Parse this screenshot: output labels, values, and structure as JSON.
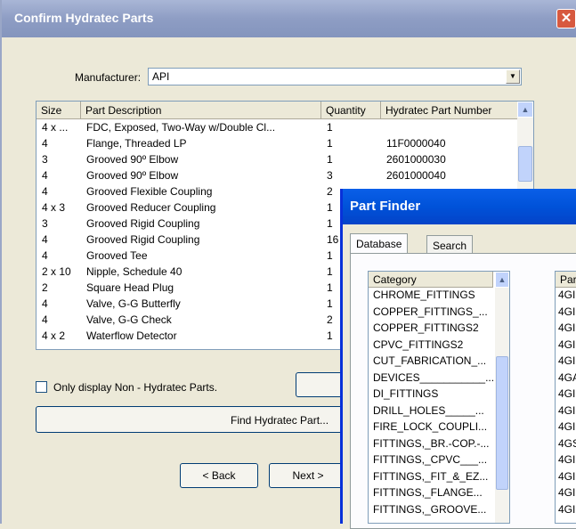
{
  "window": {
    "title": "Confirm Hydratec Parts",
    "close_glyph": "✕"
  },
  "manufacturer": {
    "label": "Manufacturer:",
    "value": "API"
  },
  "grid": {
    "columns": [
      "Size",
      "Part Description",
      "Quantity",
      "Hydratec Part Number"
    ],
    "rows": [
      [
        "4 x ...",
        "FDC, Exposed, Two-Way w/Double Cl...",
        "1",
        ""
      ],
      [
        "4",
        "Flange, Threaded LP",
        "1",
        "11F0000040"
      ],
      [
        "3",
        "Grooved 90º Elbow",
        "1",
        "2601000030"
      ],
      [
        "4",
        "Grooved 90º Elbow",
        "3",
        "2601000040"
      ],
      [
        "4",
        "Grooved Flexible Coupling",
        "2",
        ""
      ],
      [
        "4 x 3",
        "Grooved Reducer Coupling",
        "1",
        ""
      ],
      [
        "3",
        "Grooved Rigid Coupling",
        "1",
        ""
      ],
      [
        "4",
        "Grooved Rigid Coupling",
        "16",
        ""
      ],
      [
        "4",
        "Grooved Tee",
        "1",
        ""
      ],
      [
        "2 x 10",
        "Nipple, Schedule 40",
        "1",
        ""
      ],
      [
        "2",
        "Square Head Plug",
        "1",
        ""
      ],
      [
        "4",
        "Valve, G-G Butterfly",
        "1",
        ""
      ],
      [
        "4",
        "Valve, G-G Check",
        "2",
        ""
      ],
      [
        "4 x 2",
        "Waterflow Detector",
        "1",
        ""
      ]
    ]
  },
  "options": {
    "non_hydratec_label": "Only display Non - Hydratec Parts.",
    "non_hydratec_checked": false
  },
  "buttons": {
    "find": "Find Hydratec Part...",
    "back": "< Back",
    "next": "Next >"
  },
  "part_finder": {
    "title": "Part Finder",
    "tabs": [
      "Database",
      "Search"
    ],
    "active_tab": "Database",
    "category_header": "Category",
    "categories": [
      "CHROME_FITTINGS",
      "COPPER_FITTINGS_...",
      "COPPER_FITTINGS2",
      "CPVC_FITTINGS2",
      "CUT_FABRICATION_...",
      "DEVICES___________...",
      "DI_FITTINGS",
      "DRILL_HOLES_____...",
      "FIRE_LOCK_COUPLI...",
      "FITTINGS,_BR.-COP.-...",
      "FITTINGS,_CPVC___...",
      "FITTINGS,_FIT_&_EZ...",
      "FITTINGS,_FLANGE...",
      "FITTINGS,_GROOVE..."
    ],
    "part_header": "Par",
    "parts": [
      "4GI",
      "4GI",
      "4GI",
      "4GI",
      "4GI",
      "4GA",
      "4GI",
      "4GI",
      "4GI",
      "4GS",
      "4GI",
      "4GI",
      "4GI",
      "4GI"
    ]
  }
}
